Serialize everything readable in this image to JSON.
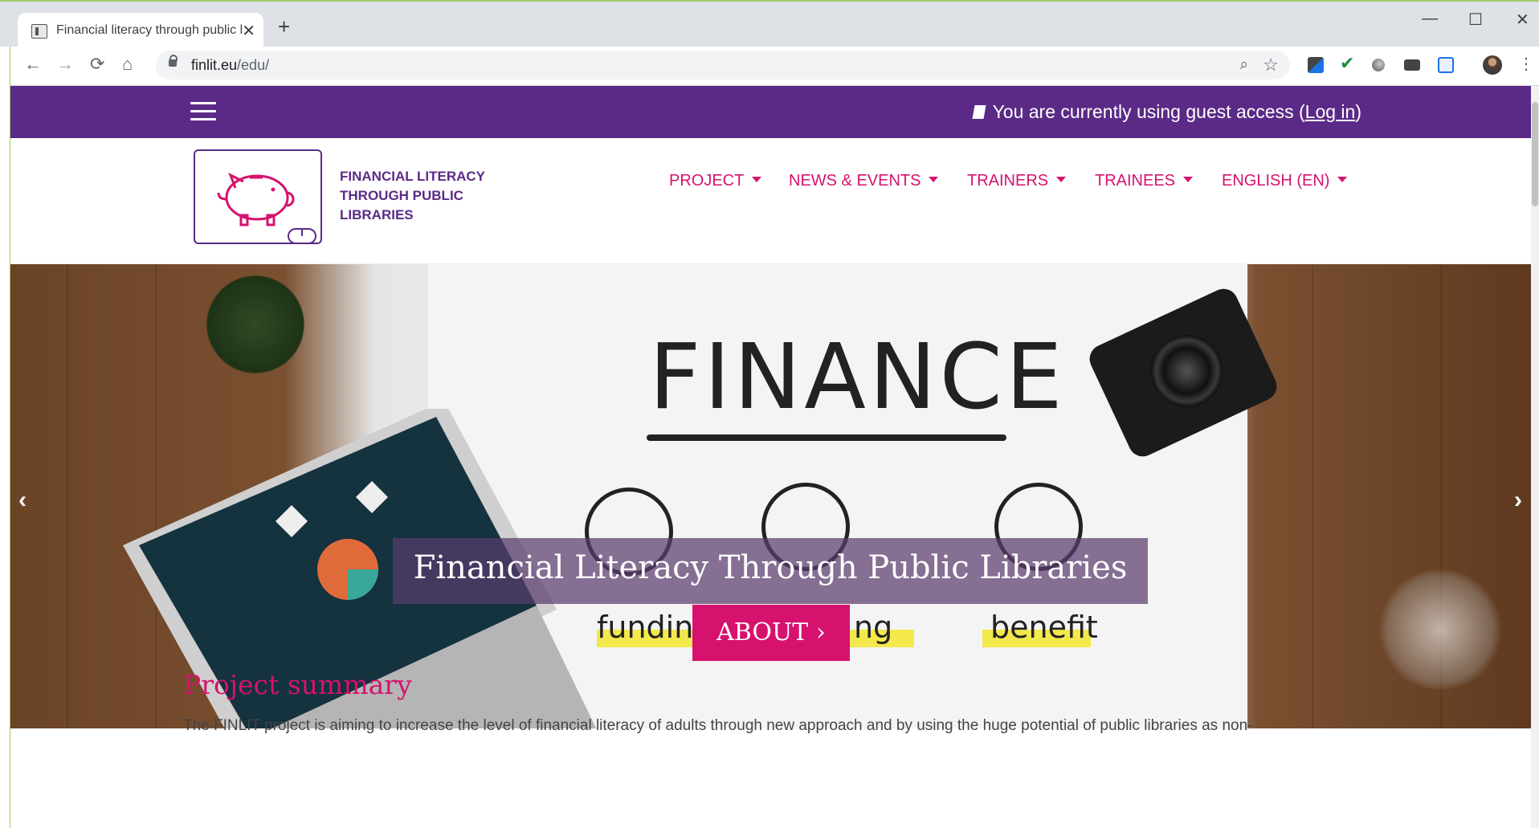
{
  "browser": {
    "tab_title": "Financial literacy through public l",
    "url_domain": "finlit.eu",
    "url_path": "/edu/",
    "new_tab_symbol": "+",
    "close_symbol": "✕",
    "minimize_symbol": "—",
    "maximize_symbol": "☐"
  },
  "site": {
    "guest_prefix": "You are currently using guest access (",
    "login_label": "Log in",
    "guest_suffix": ")",
    "logo_line1": "FINANCIAL LITERACY",
    "logo_line2": "THROUGH PUBLIC",
    "logo_line3": "LIBRARIES",
    "menu": [
      {
        "label": "PROJECT"
      },
      {
        "label": "NEWS & EVENTS"
      },
      {
        "label": "TRAINERS"
      },
      {
        "label": "TRAINEES"
      },
      {
        "label": "ENGLISH (EN)"
      }
    ]
  },
  "hero": {
    "finance_word": "FINANCE",
    "words": {
      "funding": "funding",
      "saving_tail": "ng",
      "benefit": "benefit"
    },
    "caption": "Financial Literacy Through Public Libraries",
    "button_label": "ABOUT ›",
    "prev_arrow": "‹",
    "next_arrow": "›"
  },
  "summary": {
    "title": "Project summary",
    "text": "The FINLIT project is aiming to increase the level of financial literacy of adults through new approach and by using the huge potential of public libraries as non-"
  },
  "colors": {
    "brand_purple": "#5b2a86",
    "brand_pink": "#d6126e"
  }
}
